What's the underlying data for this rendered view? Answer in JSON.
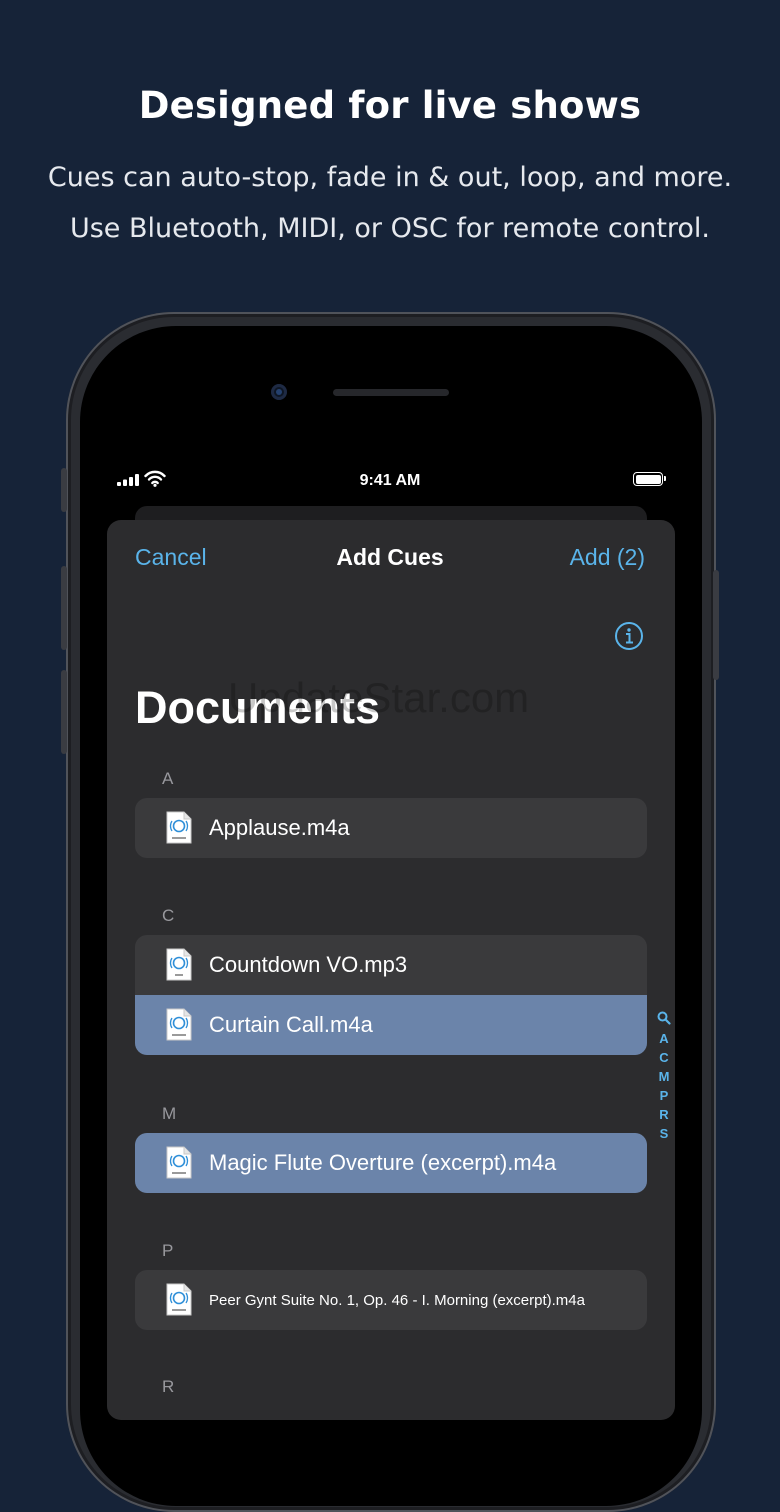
{
  "promo": {
    "headline": "Designed for live shows",
    "line1": "Cues can auto-stop, fade in & out, loop, and more.",
    "line2": "Use Bluetooth, MIDI, or OSC for remote control."
  },
  "status_bar": {
    "time": "9:41 AM",
    "icons": [
      "cellular-signal-icon",
      "wifi-icon",
      "battery-icon"
    ]
  },
  "nav": {
    "cancel": "Cancel",
    "title": "Add Cues",
    "add": "Add (2)",
    "info_icon": "info-icon"
  },
  "large_title": "Documents",
  "watermark": "UpdateStar.com",
  "sections": [
    {
      "letter": "A",
      "items": [
        {
          "name": "Applause.m4a",
          "icon": "mpeg4-audio-file-icon",
          "selected": false
        }
      ]
    },
    {
      "letter": "C",
      "items": [
        {
          "name": "Countdown VO.mp3",
          "icon": "mp3-audio-file-icon",
          "selected": false
        },
        {
          "name": "Curtain Call.m4a",
          "icon": "mpeg4-audio-file-icon",
          "selected": true
        }
      ]
    },
    {
      "letter": "M",
      "items": [
        {
          "name": "Magic Flute Overture (excerpt).m4a",
          "icon": "mpeg4-audio-file-icon",
          "selected": true
        }
      ]
    },
    {
      "letter": "P",
      "items": [
        {
          "name": "Peer Gynt Suite No. 1, Op. 46 - I. Morning (excerpt).m4a",
          "icon": "mpeg4-audio-file-icon",
          "selected": false
        }
      ]
    },
    {
      "letter": "R",
      "items": []
    }
  ],
  "section_index": [
    "A",
    "C",
    "M",
    "P",
    "R",
    "S"
  ],
  "colors": {
    "background": "#162338",
    "accent": "#5ab4ea",
    "selected_row": "#6b84aa",
    "sheet": "#2c2c2e",
    "row": "#3a3a3c"
  }
}
